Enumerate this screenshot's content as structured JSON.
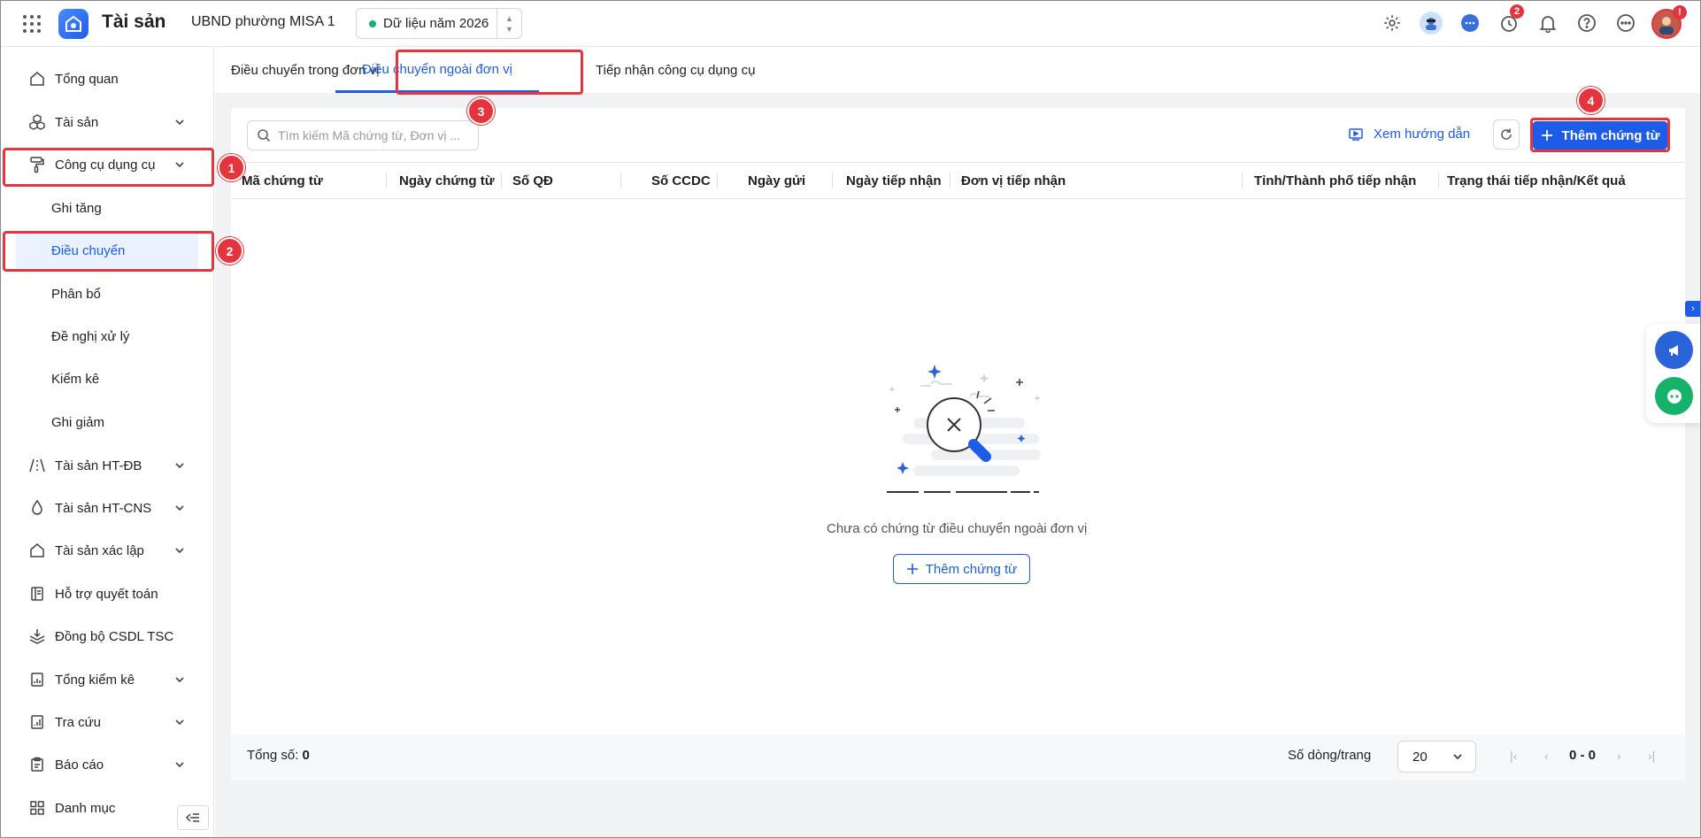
{
  "header": {
    "app_name": "Tài sản",
    "org_name": "UBND phường MISA 1",
    "year_label": "Dữ liệu năm 2026",
    "timer_badge": "2",
    "avatar_badge": "!"
  },
  "sidebar": {
    "items": [
      {
        "label": "Tổng quan",
        "icon": "home-icon"
      },
      {
        "label": "Tài sản",
        "icon": "cubes-icon"
      },
      {
        "label": "Công cụ dụng cụ",
        "icon": "paint-roller-icon"
      },
      {
        "label": "Tài sản HT-ĐB",
        "icon": "road-icon"
      },
      {
        "label": "Tài sản HT-CNS",
        "icon": "water-drop-icon"
      },
      {
        "label": "Tài sản xác lập",
        "icon": "home-outline-icon"
      },
      {
        "label": "Hỗ trợ quyết toán",
        "icon": "ledger-icon"
      },
      {
        "label": "Đồng bộ CSDL TSC",
        "icon": "sync-layers-icon"
      },
      {
        "label": "Tổng kiểm kê",
        "icon": "checklist-icon"
      },
      {
        "label": "Tra cứu",
        "icon": "chart-search-icon"
      },
      {
        "label": "Báo cáo",
        "icon": "report-icon"
      },
      {
        "label": "Danh mục",
        "icon": "grid-icon"
      }
    ],
    "sub_items": [
      "Ghi tăng",
      "Điều chuyển",
      "Phân bổ",
      "Đề nghị xử lý",
      "Kiểm kê",
      "Ghi giảm"
    ]
  },
  "tabs": [
    "Điều chuyển trong đơn vị",
    "Điều chuyển ngoài đơn vị",
    "Tiếp nhận công cụ dụng cụ"
  ],
  "toolbar": {
    "search_placeholder": "Tìm kiếm Mã chứng từ, Đơn vị ...",
    "guide_label": "Xem hướng dẫn",
    "add_label": "Thêm chứng từ"
  },
  "table": {
    "columns": [
      "Mã chứng từ",
      "Ngày chứng từ",
      "Số QĐ",
      "Số CCDC",
      "Ngày gửi",
      "Ngày tiếp nhận",
      "Đơn vị tiếp nhận",
      "Tỉnh/Thành phố tiếp nhận",
      "Trạng thái tiếp nhận/Kết quả"
    ],
    "empty_text": "Chưa có chứng từ điều chuyển ngoài đơn vị",
    "empty_button": "Thêm chứng từ"
  },
  "footer": {
    "total_label": "Tổng số:",
    "total_value": "0",
    "rows_label": "Số dòng/trang",
    "rows_value": "20",
    "range": "0 - 0"
  },
  "annotations": [
    "1",
    "2",
    "3",
    "4"
  ],
  "colors": {
    "accent": "#1d5ce6",
    "highlight": "#e5343d",
    "success": "#17b26a"
  }
}
